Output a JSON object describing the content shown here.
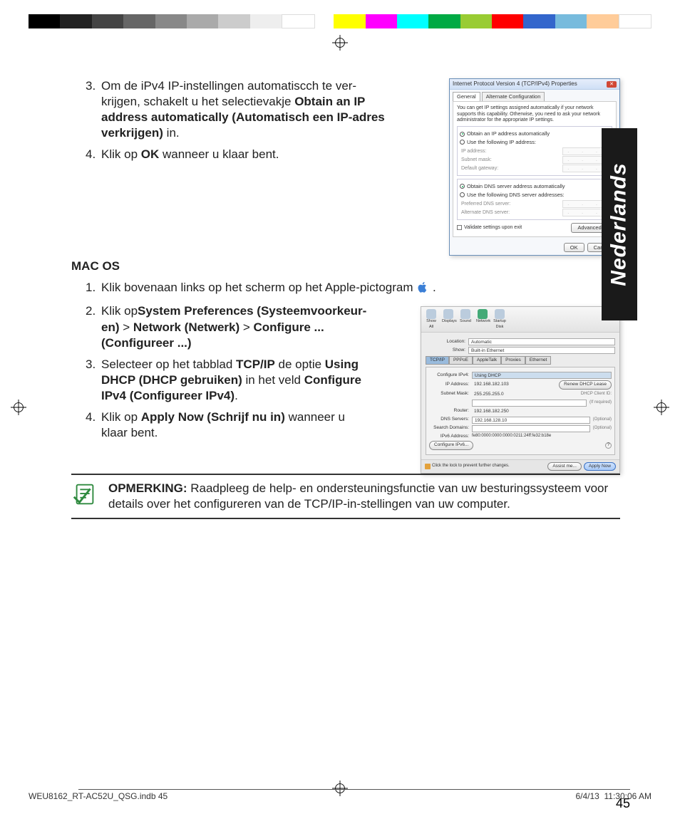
{
  "language_tab": "Nederlands",
  "page_number": "45",
  "footer": {
    "file": "WEU8162_RT-AC52U_QSG.indb   45",
    "date": "6/4/13",
    "time": "11:30:06 AM"
  },
  "windows": {
    "title": "Internet Protocol Version 4 (TCP/IPv4) Properties",
    "tabs": {
      "general": "General",
      "alt": "Alternate Configuration"
    },
    "intro": "You can get IP settings assigned automatically if your network supports this capability. Otherwise, you need to ask your network administrator for the appropriate IP settings.",
    "opt_auto_ip": "Obtain an IP address automatically",
    "opt_use_ip": "Use the following IP address:",
    "lbl_ip": "IP address:",
    "lbl_subnet": "Subnet mask:",
    "lbl_gateway": "Default gateway:",
    "opt_auto_dns": "Obtain DNS server address automatically",
    "opt_use_dns": "Use the following DNS server addresses:",
    "lbl_pref_dns": "Preferred DNS server:",
    "lbl_alt_dns": "Alternate DNS server:",
    "chk_validate": "Validate settings upon exit",
    "btn_advanced": "Advanced...",
    "btn_ok": "OK",
    "btn_cancel": "Cancel"
  },
  "mac": {
    "toolbar": {
      "showall": "Show All",
      "displays": "Displays",
      "sound": "Sound",
      "network": "Network",
      "startup": "Startup Disk"
    },
    "lbl_location": "Location:",
    "val_location": "Automatic",
    "lbl_show": "Show:",
    "val_show": "Built-in Ethernet",
    "tabs": {
      "tcpip": "TCP/IP",
      "pppoe": "PPPoE",
      "appletalk": "AppleTalk",
      "proxies": "Proxies",
      "ethernet": "Ethernet"
    },
    "lbl_configure": "Configure IPv4:",
    "val_configure": "Using DHCP",
    "lbl_ip": "IP Address:",
    "val_ip": "192.168.182.103",
    "btn_renew": "Renew DHCP Lease",
    "lbl_subnet": "Subnet Mask:",
    "val_subnet": "255.255.255.0",
    "lbl_clientid": "DHCP Client ID:",
    "hint_clientid": "(If required)",
    "lbl_router": "Router:",
    "val_router": "192.168.182.250",
    "lbl_dns": "DNS Servers:",
    "val_dns": "192.168.128.10",
    "hint_optional": "(Optional)",
    "lbl_search": "Search Domains:",
    "lbl_ipv6": "IPv6 Address:",
    "val_ipv6": "fe80:0000:0000:0000:0211:24ff:fe32:b18e",
    "btn_conf_ipv6": "Configure IPv6...",
    "lock_text": "Click the lock to prevent further changes.",
    "btn_assist": "Assist me...",
    "btn_apply": "Apply Now"
  },
  "steps_win": {
    "s3_num": "3.",
    "s3_a": "Om de iPv4 IP-instellingen automatiscch te ver-krijgen, schakelt u het selectievakje ",
    "s3_b": "Obtain an IP address automatically (Automatisch een IP-adres verkrijgen)",
    "s3_c": " in.",
    "s4_num": "4.",
    "s4_a": "Klik op ",
    "s4_b": "OK",
    "s4_c": " wanneer u klaar bent."
  },
  "macos_heading": "MAC OS",
  "steps_mac": {
    "s1_num": "1.",
    "s1_a": "Klik bovenaan links op het scherm op het Apple-pictogram ",
    "s1_b": ".",
    "s2_num": "2.",
    "s2_a": "Klik op",
    "s2_b": "System Preferences (Systeemvoorkeur-en)",
    "s2_c": " > ",
    "s2_d": "Network (Netwerk)",
    "s2_e": " > ",
    "s2_f": "Configure ... (Configureer ...)",
    "s3_num": "3.",
    "s3_a": "Selecteer op het tabblad ",
    "s3_b": "TCP/IP",
    "s3_c": " de optie ",
    "s3_d": "Using DHCP (DHCP gebruiken)",
    "s3_e": " in het veld ",
    "s3_f": "Configure IPv4 (Configureer IPv4)",
    "s3_g": ".",
    "s4_num": "4.",
    "s4_a": "Klik op ",
    "s4_b": "Apply Now (Schrijf nu in)",
    "s4_c": " wanneer u klaar bent."
  },
  "note": {
    "label": "OPMERKING:",
    "body": "  Raadpleeg de help- en ondersteuningsfunctie van uw besturingssysteem voor details over het configureren van de TCP/IP-in-stellingen van uw computer."
  }
}
